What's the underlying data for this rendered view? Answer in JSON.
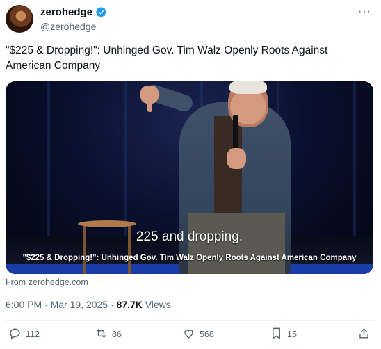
{
  "author": {
    "name": "zerohedge",
    "handle": "@zerohedge",
    "verified_color": "#1d9bf0"
  },
  "more_label": "···",
  "tweet": {
    "text": "\"$225 & Dropping!\": Unhinged Gov. Tim Walz Openly Roots Against American Company"
  },
  "media": {
    "subtitle": "225 and dropping.",
    "caption": "\"$225 & Dropping!\": Unhinged Gov. Tim Walz Openly Roots Against American Company"
  },
  "source": "From zerohedge.com",
  "meta": {
    "time": "6:00 PM",
    "sep1": " · ",
    "date": "Mar 19, 2025",
    "sep2": " · ",
    "views_count": "87.7K",
    "views_label": " Views"
  },
  "actions": {
    "replies": "112",
    "reposts": "86",
    "likes": "568",
    "bookmarks": "15"
  },
  "icons": [
    "verified-badge-icon",
    "more-icon",
    "reply-icon",
    "repost-icon",
    "like-icon",
    "bookmark-icon",
    "share-icon"
  ]
}
